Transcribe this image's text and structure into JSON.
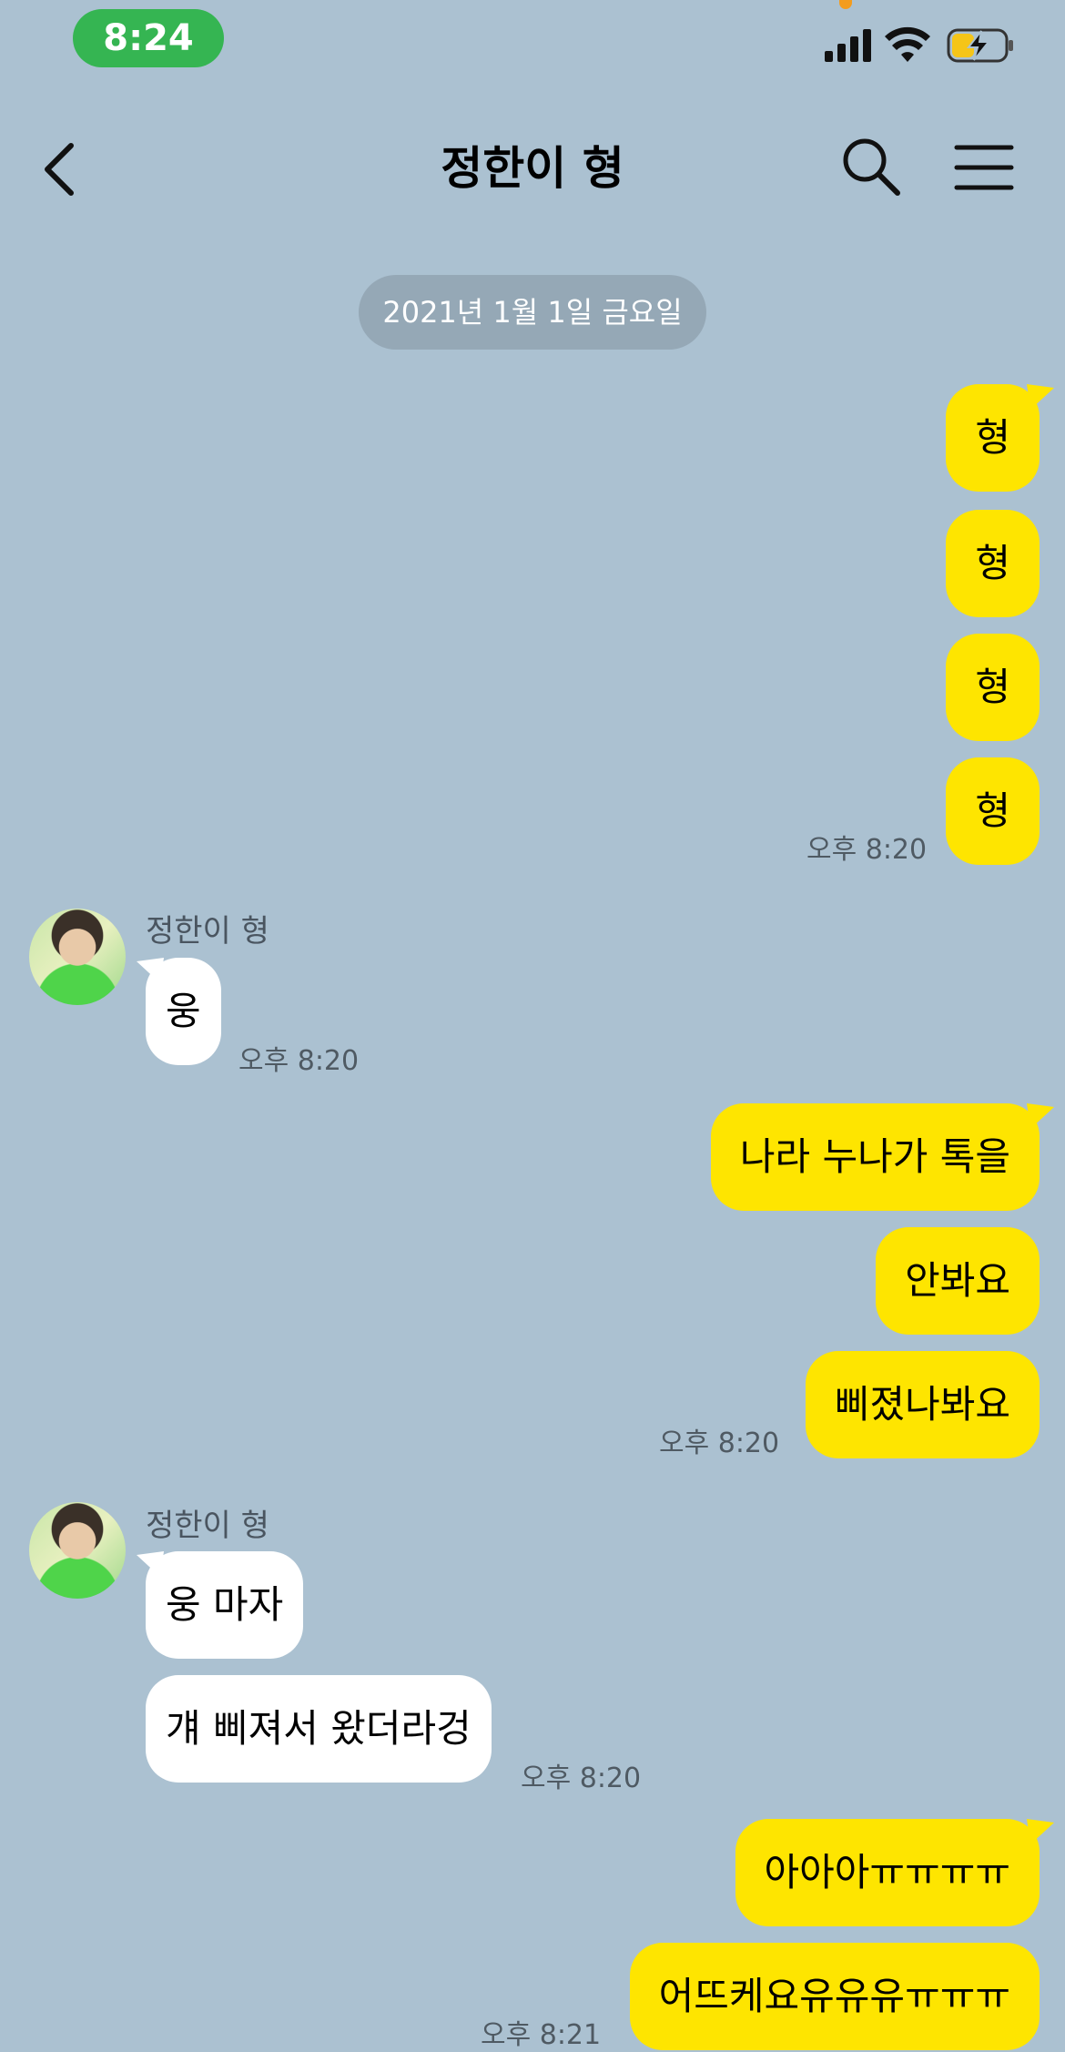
{
  "status_bar": {
    "time": "8:24"
  },
  "header": {
    "title": "정한이 형"
  },
  "date_separator": "2021년 1월 1일 금요일",
  "messages": [
    {
      "from": "me",
      "text": "형"
    },
    {
      "from": "me",
      "text": "형"
    },
    {
      "from": "me",
      "text": "형"
    },
    {
      "from": "me",
      "text": "형",
      "time": "오후 8:20"
    },
    {
      "from": "other",
      "sender": "정한이 형",
      "text": "웅",
      "time": "오후 8:20"
    },
    {
      "from": "me",
      "text": "나라 누나가 톡을"
    },
    {
      "from": "me",
      "text": "안봐요"
    },
    {
      "from": "me",
      "text": "삐졌나봐요",
      "time": "오후 8:20"
    },
    {
      "from": "other",
      "sender": "정한이 형",
      "text": "웅 마자"
    },
    {
      "from": "other",
      "text": "걔 삐져서 왔더라겅",
      "time": "오후 8:20"
    },
    {
      "from": "me",
      "text": "아아아ㅠㅠㅠㅠ"
    },
    {
      "from": "me",
      "text": "어뜨케요유유유ㅠㅠㅠ",
      "time": "오후 8:21"
    }
  ],
  "icons": [
    "back-icon",
    "search-icon",
    "menu-icon",
    "signal-icon",
    "wifi-icon",
    "battery-charging-icon"
  ]
}
